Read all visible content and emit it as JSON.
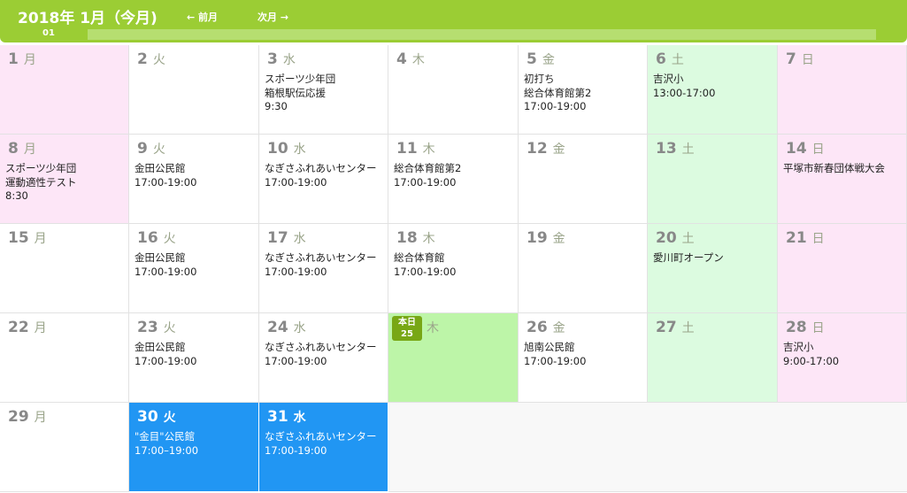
{
  "header": {
    "title": "2018年 1月（今月)",
    "prev_label": "← 前月",
    "next_label": "次月 →",
    "day_tab": "01",
    "bg_color": "#9bcd34"
  },
  "today_badge": {
    "label": "本日",
    "day": "25"
  },
  "weeks": [
    [
      {
        "day": "1",
        "dow": "月",
        "kind": "sun",
        "events": []
      },
      {
        "day": "2",
        "dow": "火",
        "kind": "",
        "events": []
      },
      {
        "day": "3",
        "dow": "水",
        "kind": "",
        "events": [
          "スポーツ少年団",
          "箱根駅伝応援",
          "9:30"
        ]
      },
      {
        "day": "4",
        "dow": "木",
        "kind": "",
        "events": []
      },
      {
        "day": "5",
        "dow": "金",
        "kind": "",
        "events": [
          "初打ち",
          "総合体育館第2",
          "17:00-19:00"
        ]
      },
      {
        "day": "6",
        "dow": "土",
        "kind": "sat",
        "events": [
          "吉沢小",
          "13:00-17:00"
        ]
      },
      {
        "day": "7",
        "dow": "日",
        "kind": "sun",
        "events": []
      }
    ],
    [
      {
        "day": "8",
        "dow": "月",
        "kind": "sun",
        "events": [
          "スポーツ少年団",
          "運動適性テスト",
          "8:30"
        ]
      },
      {
        "day": "9",
        "dow": "火",
        "kind": "",
        "events": [
          "金田公民館",
          "17:00-19:00"
        ]
      },
      {
        "day": "10",
        "dow": "水",
        "kind": "",
        "events": [
          "なぎさふれあいセンター",
          "17:00-19:00"
        ]
      },
      {
        "day": "11",
        "dow": "木",
        "kind": "",
        "events": [
          "総合体育館第2",
          "17:00-19:00"
        ]
      },
      {
        "day": "12",
        "dow": "金",
        "kind": "",
        "events": []
      },
      {
        "day": "13",
        "dow": "土",
        "kind": "sat",
        "events": []
      },
      {
        "day": "14",
        "dow": "日",
        "kind": "sun",
        "events": [
          "平塚市新春団体戦大会"
        ]
      }
    ],
    [
      {
        "day": "15",
        "dow": "月",
        "kind": "",
        "events": []
      },
      {
        "day": "16",
        "dow": "火",
        "kind": "",
        "events": [
          "金田公民館",
          "17:00-19:00"
        ]
      },
      {
        "day": "17",
        "dow": "水",
        "kind": "",
        "events": [
          "なぎさふれあいセンター",
          "17:00-19:00"
        ]
      },
      {
        "day": "18",
        "dow": "木",
        "kind": "",
        "events": [
          "総合体育館",
          "17:00-19:00"
        ]
      },
      {
        "day": "19",
        "dow": "金",
        "kind": "",
        "events": []
      },
      {
        "day": "20",
        "dow": "土",
        "kind": "sat",
        "events": [
          "愛川町オープン"
        ]
      },
      {
        "day": "21",
        "dow": "日",
        "kind": "sun",
        "events": []
      }
    ],
    [
      {
        "day": "22",
        "dow": "月",
        "kind": "",
        "events": []
      },
      {
        "day": "23",
        "dow": "火",
        "kind": "",
        "events": [
          "金田公民館",
          "17:00-19:00"
        ]
      },
      {
        "day": "24",
        "dow": "水",
        "kind": "",
        "events": [
          "なぎさふれあいセンター",
          "17:00-19:00"
        ]
      },
      {
        "day": "25",
        "dow": "木",
        "kind": "today",
        "events": []
      },
      {
        "day": "26",
        "dow": "金",
        "kind": "",
        "events": [
          "旭南公民館",
          "17:00-19:00"
        ]
      },
      {
        "day": "27",
        "dow": "土",
        "kind": "sat",
        "events": []
      },
      {
        "day": "28",
        "dow": "日",
        "kind": "sun",
        "events": [
          "吉沢小",
          "9:00-17:00"
        ]
      }
    ],
    [
      {
        "day": "29",
        "dow": "月",
        "kind": "",
        "events": []
      },
      {
        "day": "30",
        "dow": "火",
        "kind": "blue",
        "events": [
          "\"金目\"公民館",
          "17:00–19:00"
        ]
      },
      {
        "day": "31",
        "dow": "水",
        "kind": "blue",
        "events": [
          "なぎさふれあいセンター",
          "17:00-19:00"
        ]
      }
    ]
  ],
  "colors": {
    "sunday_bg": "#fde6f7",
    "saturday_bg": "#dcfbe0",
    "today_bg": "#bdf5a8",
    "selected_bg": "#2196f3"
  }
}
